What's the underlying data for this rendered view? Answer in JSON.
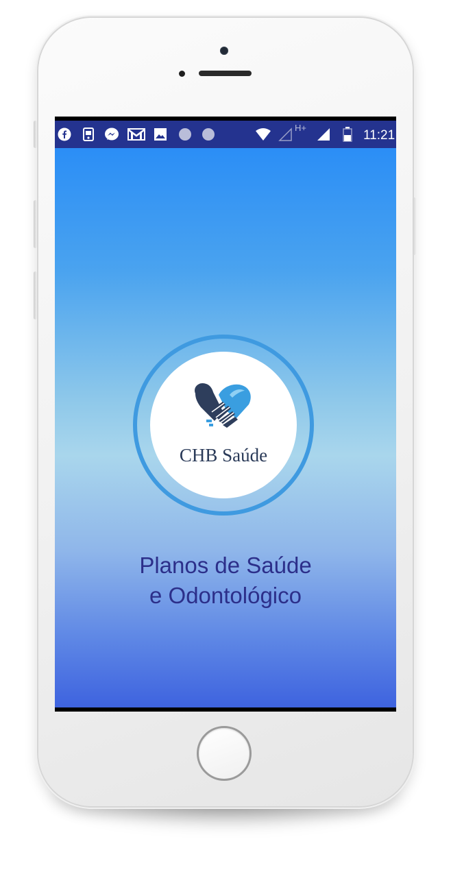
{
  "status_bar": {
    "time": "11:21",
    "network_label": "H+",
    "left_icons": [
      "facebook-icon",
      "sim-card-icon",
      "messenger-icon",
      "gmail-icon",
      "image-icon",
      "notification-dot-icon",
      "notification-dot-icon"
    ],
    "right_icons": [
      "wifi-icon",
      "signal-empty-icon",
      "signal-icon",
      "battery-icon"
    ],
    "background_color": "#24338f"
  },
  "splash": {
    "logo_text": "CHB Saúde",
    "logo_icon": "handshake-heart-icon",
    "tagline_line1": "Planos de Saúde",
    "tagline_line2": "e Odontológico",
    "gradient_top": "#2b8ef6",
    "gradient_middle": "#a9d6ec",
    "gradient_bottom": "#3e63df",
    "tagline_color": "#2c2f8a"
  },
  "device": {
    "frame": "white-smartphone",
    "home_button": "home-button"
  }
}
